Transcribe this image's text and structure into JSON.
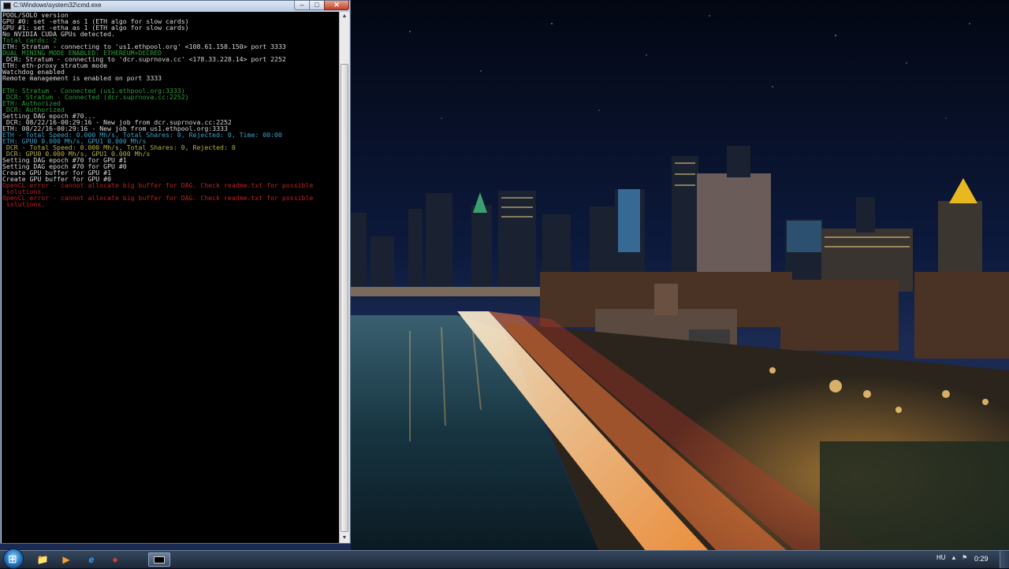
{
  "window": {
    "title": "C:\\Windows\\system32\\cmd.exe",
    "min_glyph": "–",
    "max_glyph": "□",
    "close_glyph": "✕"
  },
  "console": {
    "lines": [
      {
        "text": "POOL/SOLO version",
        "color": "#d8d8d8"
      },
      {
        "text": "GPU #0: set -etha as 1 (ETH algo for slow cards)",
        "color": "#d8d8d8"
      },
      {
        "text": "GPU #1: set -etha as 1 (ETH algo for slow cards)",
        "color": "#d8d8d8"
      },
      {
        "text": "No NVIDIA CUDA GPUs detected.",
        "color": "#d8d8d8"
      },
      {
        "text": "Total cards: 2",
        "color": "#2f9e3a"
      },
      {
        "text": "ETH: Stratum - connecting to 'us1.ethpool.org' <108.61.158.150> port 3333",
        "color": "#d8d8d8"
      },
      {
        "text": "DUAL MINING MODE ENABLED: ETHEREUM+DECRED",
        "color": "#2f9e3a"
      },
      {
        "text": " DCR: Stratum - connecting to 'dcr.suprnova.cc' <178.33.228.14> port 2252",
        "color": "#d8d8d8"
      },
      {
        "text": "ETH: eth-proxy stratum mode",
        "color": "#d8d8d8"
      },
      {
        "text": "Watchdog enabled",
        "color": "#d8d8d8"
      },
      {
        "text": "Remote management is enabled on port 3333",
        "color": "#d8d8d8"
      },
      {
        "text": "",
        "color": "#d8d8d8"
      },
      {
        "text": "ETH: Stratum - Connected (us1.ethpool.org:3333)",
        "color": "#2f9e3a"
      },
      {
        "text": " DCR: Stratum - Connected (dcr.suprnova.cc:2252)",
        "color": "#2f9e3a"
      },
      {
        "text": "ETH: Authorized",
        "color": "#2f9e3a"
      },
      {
        "text": " DCR: Authorized",
        "color": "#2f9e3a"
      },
      {
        "text": "Setting DAG epoch #70...",
        "color": "#d8d8d8"
      },
      {
        "text": " DCR: 08/22/16-00:29:16 - New job from dcr.suprnova.cc:2252",
        "color": "#d8d8d8"
      },
      {
        "text": "ETH: 08/22/16-00:29:16 - New job from us1.ethpool.org:3333",
        "color": "#d8d8d8"
      },
      {
        "text": "ETH - Total Speed: 0.000 Mh/s, Total Shares: 0, Rejected: 0, Time: 00:00",
        "color": "#3aa0c8"
      },
      {
        "text": "ETH: GPU0 0.000 Mh/s, GPU1 0.000 Mh/s",
        "color": "#3aa0c8"
      },
      {
        "text": " DCR - Total Speed: 0.000 Mh/s, Total Shares: 0, Rejected: 0",
        "color": "#b8b040"
      },
      {
        "text": " DCR: GPU0 0.000 Mh/s, GPU1 0.000 Mh/s",
        "color": "#b8b040"
      },
      {
        "text": "Setting DAG epoch #70 for GPU #1",
        "color": "#d8d8d8"
      },
      {
        "text": "Setting DAG epoch #70 for GPU #0",
        "color": "#d8d8d8"
      },
      {
        "text": "Create GPU buffer for GPU #1",
        "color": "#d8d8d8"
      },
      {
        "text": "Create GPU buffer for GPU #0",
        "color": "#d8d8d8"
      },
      {
        "text": "OpenCL error - cannot allocate big buffer for DAG. Check readme.txt for possible",
        "color": "#c02020"
      },
      {
        "text": " solutions.",
        "color": "#c02020"
      },
      {
        "text": "OpenCL error - cannot allocate big buffer for DAG. Check readme.txt for possible",
        "color": "#c02020"
      },
      {
        "text": " solutions.",
        "color": "#c02020"
      }
    ]
  },
  "taskbar": {
    "pinned": [
      {
        "name": "explorer-icon",
        "glyph": "📁"
      },
      {
        "name": "media-player-icon",
        "glyph": "▶"
      },
      {
        "name": "internet-explorer-icon",
        "glyph": "e"
      },
      {
        "name": "chrome-icon",
        "glyph": "●"
      }
    ],
    "language": "HU",
    "tray_icons": "▲ ⚑",
    "clock": "0:29"
  },
  "colors": {
    "sky": "#0b1430",
    "water": "#0f2a34",
    "lights": "#ffb347"
  }
}
